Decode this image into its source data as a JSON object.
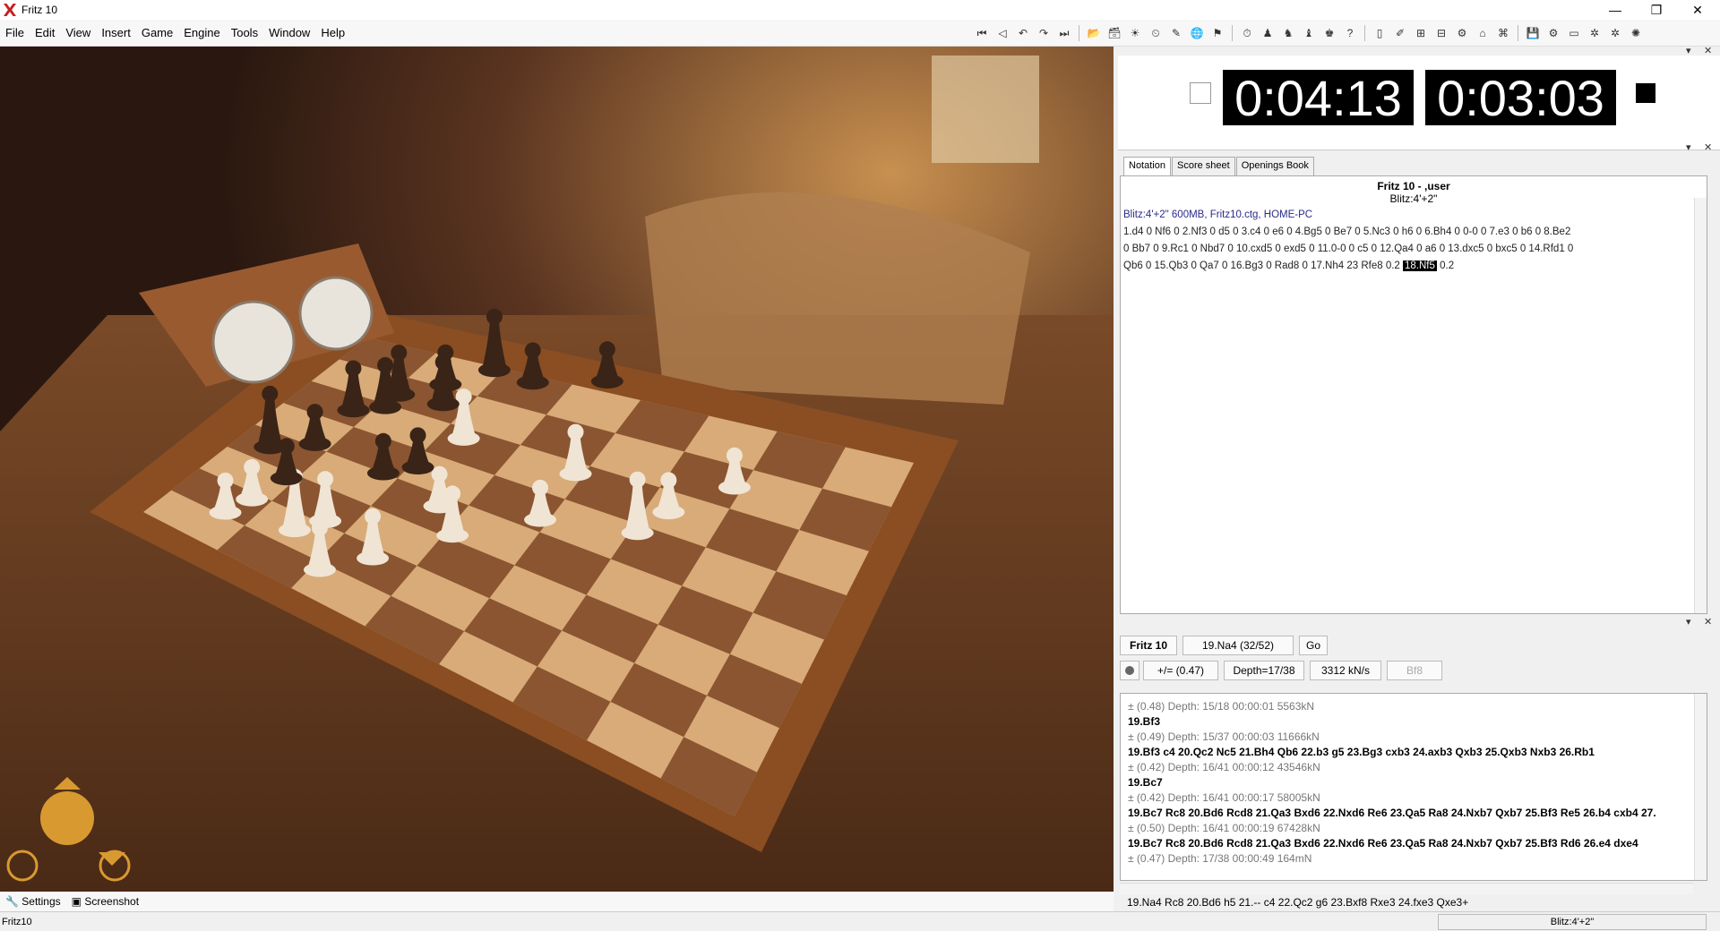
{
  "window": {
    "title": "Fritz 10",
    "minimize": "—",
    "restore": "❐",
    "close": "✕"
  },
  "menu": [
    "File",
    "Edit",
    "View",
    "Insert",
    "Game",
    "Engine",
    "Tools",
    "Window",
    "Help"
  ],
  "toolbar_icons": [
    "first-move-icon",
    "prev-move-icon",
    "back-icon",
    "forward-icon",
    "last-move-icon",
    "open-icon",
    "database-icon",
    "engine-icon",
    "timer-icon",
    "ruler-icon",
    "globe-icon",
    "flag-icon",
    "clock-icon",
    "pawn-icon",
    "fritz-icon",
    "skill-icon",
    "trophy-icon",
    "help-icon",
    "book-icon",
    "pen-icon",
    "board-icon",
    "layout-icon",
    "network-icon",
    "monitor-icon",
    "chat-icon",
    "save-icon",
    "settings-icon",
    "tray-icon",
    "gear-icon",
    "gear2-icon",
    "flash-icon"
  ],
  "toolbar_glyphs": [
    "⏮",
    "◁",
    "↶",
    "↷",
    "⏭",
    "📂",
    "🗃",
    "☀",
    "⏲",
    "✎",
    "🌐",
    "⚑",
    "⏱",
    "♟",
    "♞",
    "♝",
    "♚",
    "?",
    "▯",
    "✐",
    "⊞",
    "⊟",
    "⚙",
    "⌂",
    "⌘",
    "💾",
    "⚙",
    "▭",
    "✲",
    "✲",
    "✺"
  ],
  "clocks": {
    "white_time": "0:04:13",
    "black_time": "0:03:03"
  },
  "tabs": [
    "Notation",
    "Score sheet",
    "Openings Book"
  ],
  "notation": {
    "header1": "Fritz 10 - ,user",
    "header2": "Blitz:4'+2\"",
    "meta": "Blitz:4'+2\"   600MB, Fritz10.ctg, HOME-PC",
    "moves_line1": "1.d4  0  Nf6  0  2.Nf3  0  d5  0  3.c4  0  e6  0  4.Bg5  0  Be7  0  5.Nc3  0  h6  0  6.Bh4  0  0-0  0  7.e3  0  b6  0  8.Be2",
    "moves_line2": "0  Bb7  0  9.Rc1  0  Nbd7  0  10.cxd5  0  exd5  0  11.0-0  0  c5  0  12.Qa4  0  a6  0  13.dxc5  0  bxc5  0  14.Rfd1  0",
    "moves_line3_a": "Qb6  0  15.Qb3  0  Qa7  0  16.Bg3  0  Rad8  0  17.Nh4  23  Rfe8  0.2",
    "current_move": "18.Nf5",
    "moves_line3_b": "0.2"
  },
  "engine": {
    "name": "Fritz 10",
    "current_move": "19.Na4 (32/52)",
    "go": "Go",
    "eval": "+/= (0.47)",
    "depth": "Depth=17/38",
    "speed": "3312 kN/s",
    "best": "Bf8",
    "lines": [
      {
        "type": "info",
        "text": "±  (0.48)   Depth: 15/18   00:00:01   5563kN"
      },
      {
        "type": "mv",
        "text": "19.Bf3"
      },
      {
        "type": "info",
        "text": "±  (0.49)   Depth: 15/37   00:00:03   11666kN"
      },
      {
        "type": "mv",
        "text": "19.Bf3 c4 20.Qc2 Nc5 21.Bh4 Qb6 22.b3 g5 23.Bg3 cxb3 24.axb3 Qxb3 25.Qxb3 Nxb3 26.Rb1"
      },
      {
        "type": "info",
        "text": "±  (0.42)   Depth: 16/41   00:00:12   43546kN"
      },
      {
        "type": "mv",
        "text": "19.Bc7"
      },
      {
        "type": "info",
        "text": "±  (0.42)   Depth: 16/41   00:00:17   58005kN"
      },
      {
        "type": "mv",
        "text": "19.Bc7 Rc8 20.Bd6 Rcd8 21.Qa3 Bxd6 22.Nxd6 Re6 23.Qa5 Ra8 24.Nxb7 Qxb7 25.Bf3 Re5 26.b4 cxb4 27."
      },
      {
        "type": "info",
        "text": "±  (0.50)   Depth: 16/41   00:00:19   67428kN"
      },
      {
        "type": "mv",
        "text": "19.Bc7 Rc8 20.Bd6 Rcd8 21.Qa3 Bxd6 22.Nxd6 Re6 23.Qa5 Ra8 24.Nxb7 Qxb7 25.Bf3 Rd6 26.e4 dxe4"
      },
      {
        "type": "info",
        "text": "±  (0.47)   Depth: 17/38   00:00:49   164mN"
      }
    ],
    "best_line": "19.Na4 Rc8 20.Bd6 h5 21.-- c4 22.Qc2 g6 23.Bxf8 Rxe3 24.fxe3 Qxe3+"
  },
  "bottom": {
    "settings": "Settings",
    "screenshot": "Screenshot"
  },
  "status": {
    "left": "Fritz10",
    "right": "Blitz:4'+2\""
  },
  "colors": {
    "clock_bg": "#000000",
    "notation_text": "#2a2a8a",
    "highlight": "#000000"
  }
}
